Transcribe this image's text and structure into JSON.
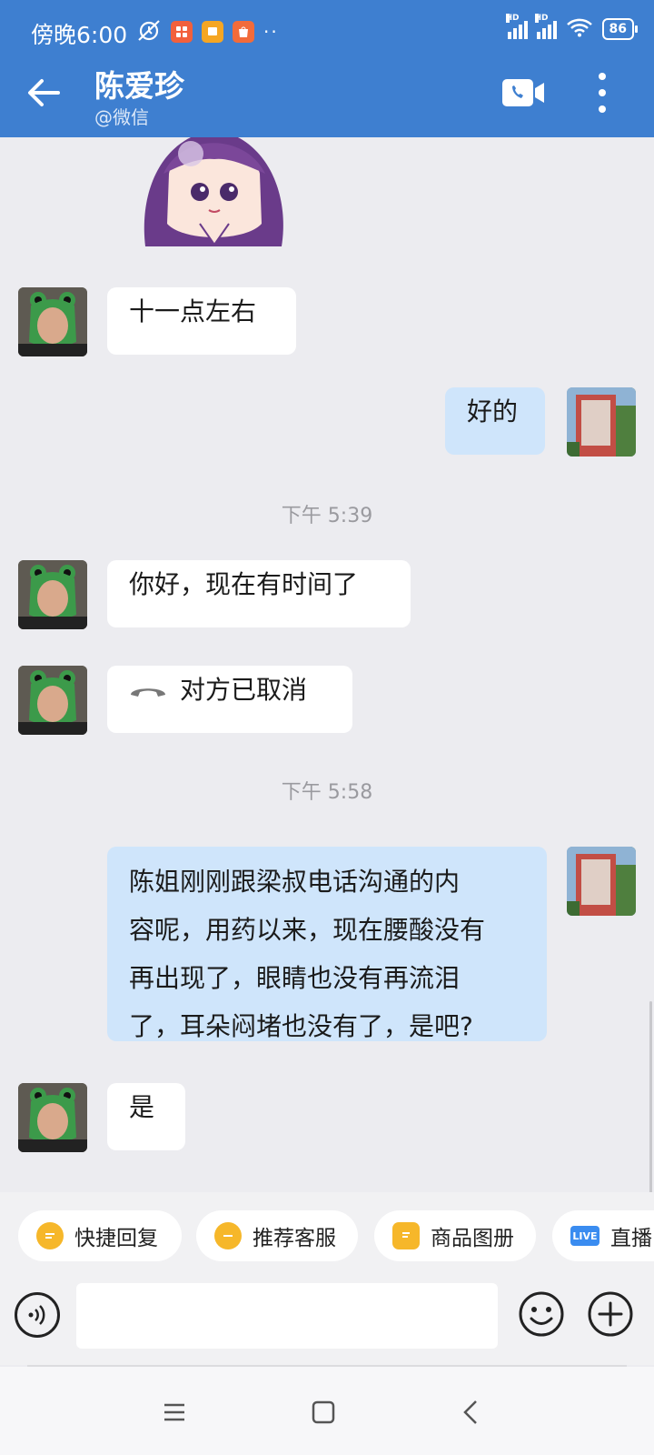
{
  "status_bar": {
    "time": "傍晚6:00",
    "battery": "86",
    "network_label": "HD"
  },
  "header": {
    "contact_name": "陈爱珍",
    "contact_source": "@微信"
  },
  "messages": [
    {
      "side": "left",
      "type": "text",
      "text": "十一点左右"
    },
    {
      "side": "right",
      "type": "text",
      "text": "好的"
    },
    {
      "type": "timestamp",
      "text": "下午 5:39"
    },
    {
      "side": "left",
      "type": "text",
      "text": "你好，现在有时间了"
    },
    {
      "side": "left",
      "type": "call",
      "text": "对方已取消"
    },
    {
      "type": "timestamp",
      "text": "下午 5:58"
    },
    {
      "side": "right",
      "type": "text",
      "lines": [
        "陈姐刚刚跟梁叔电话沟通的内",
        "容呢，用药以来，现在腰酸没有",
        "再出现了，眼睛也没有再流泪",
        "了，耳朵闷堵也没有了，是吧?"
      ]
    },
    {
      "side": "left",
      "type": "text",
      "text": "是"
    }
  ],
  "quick_actions": [
    {
      "label": "快捷回复",
      "icon": "quick-reply-icon"
    },
    {
      "label": "推荐客服",
      "icon": "recommend-service-icon"
    },
    {
      "label": "商品图册",
      "icon": "product-album-icon"
    },
    {
      "label": "直播",
      "icon": "live-icon",
      "badge": "LIVE"
    }
  ],
  "input": {
    "value": "",
    "placeholder": ""
  },
  "colors": {
    "header": "#3e7fd0",
    "background": "#ececf0",
    "bubble_self": "#cfe5fb",
    "bubble_other": "#ffffff",
    "chip_icon": "#f6b72a"
  }
}
